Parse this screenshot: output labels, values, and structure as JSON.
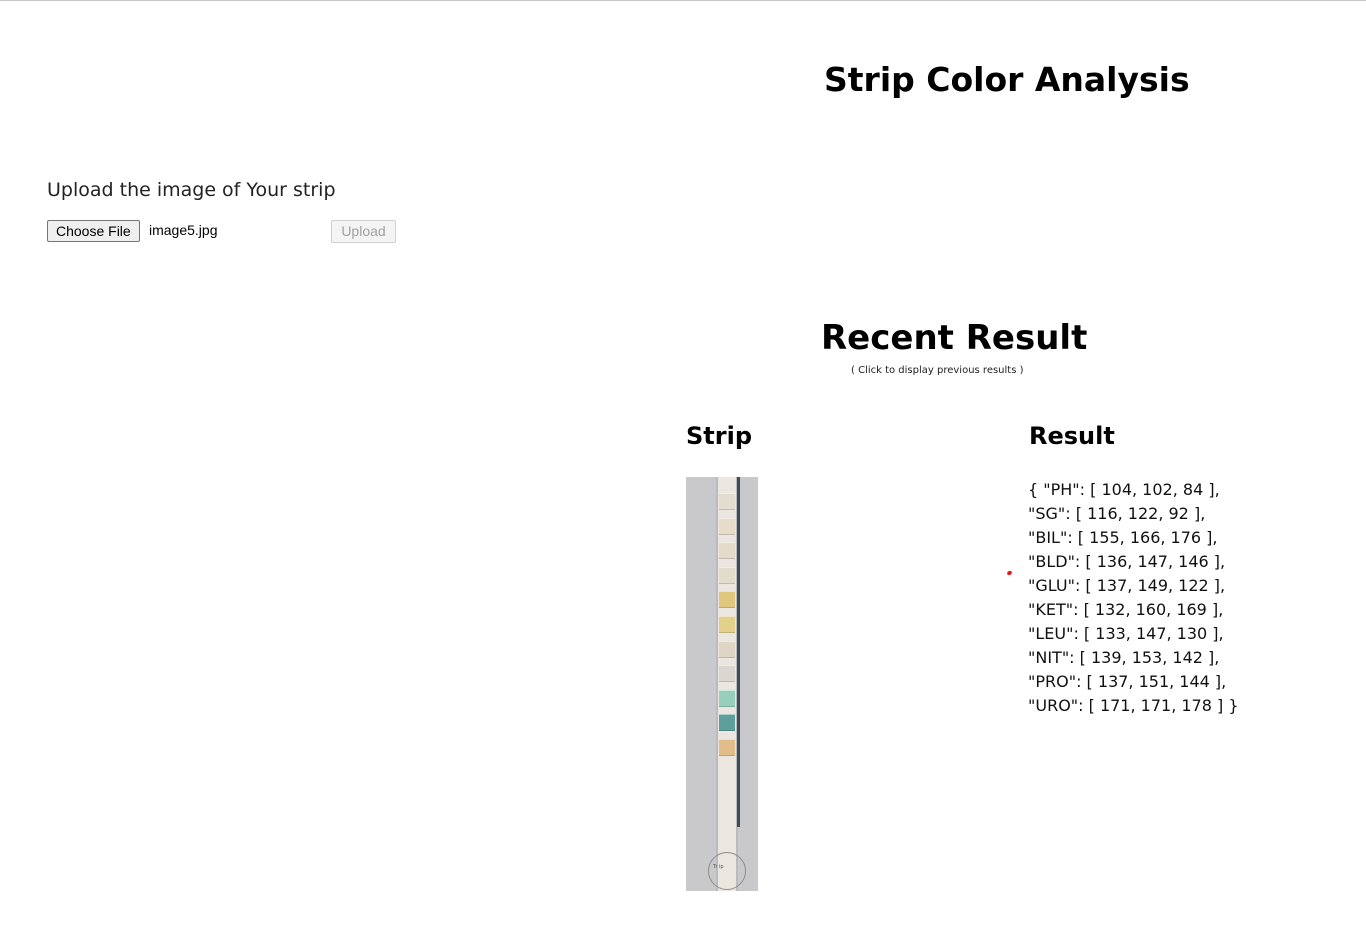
{
  "page": {
    "title": "Strip Color Analysis"
  },
  "upload": {
    "label": "Upload the image of Your strip",
    "choose_file_label": "Choose File",
    "file_name": "image5.jpg",
    "upload_label": "Upload"
  },
  "recent": {
    "title": "Recent Result",
    "hint": "( Click to display previous results )",
    "strip_heading": "Strip",
    "result_heading": "Result",
    "strip_image_text": "Tr ip",
    "pads": [
      {
        "color": "#e3ddd0"
      },
      {
        "color": "#e6dcc9"
      },
      {
        "color": "#e4dbcb"
      },
      {
        "color": "#e3dccd"
      },
      {
        "color": "#e0c77e"
      },
      {
        "color": "#e3d08a"
      },
      {
        "color": "#dfd5c4"
      },
      {
        "color": "#d9d7cf"
      },
      {
        "color": "#98cfbc"
      },
      {
        "color": "#5f9f9b"
      },
      {
        "color": "#e2bd8a"
      }
    ],
    "result_lines": [
      "{ \"PH\": [ 104, 102, 84 ],",
      "\"SG\": [ 116, 122, 92 ],",
      "\"BIL\": [ 155, 166, 176 ],",
      "\"BLD\": [ 136, 147, 146 ],",
      "\"GLU\": [ 137, 149, 122 ],",
      "\"KET\": [ 132, 160, 169 ],",
      "\"LEU\": [ 133, 147, 130 ],",
      "\"NIT\": [ 139, 153, 142 ],",
      "\"PRO\": [ 137, 151, 144 ],",
      "\"URO\": [ 171, 171, 178 ] }"
    ]
  },
  "colors": {
    "annotation_dot": "#e21b1b"
  }
}
